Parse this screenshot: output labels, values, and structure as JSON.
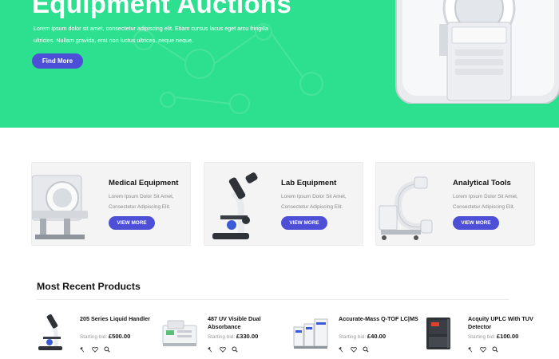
{
  "hero": {
    "title": "Equipment Auctions",
    "text": "Lorem ipsum dolor sit amet, consectetur adipiscing elit. Etiam cursus lacus eget arcu fringilla ultricies. Nullam gravida, erat non luctus ultrices, neque neque.",
    "button_label": "Find More"
  },
  "categories": [
    {
      "title": "Medical Equipment",
      "desc": "Lorem Ipsum Dolor Sit Amet, Consectetur Adipiscing Elit.",
      "button_label": "VIEW MORE",
      "icon": "mri-scanner-icon"
    },
    {
      "title": "Lab Equipment",
      "desc": "Lorem Ipsum Dolor Sit Amet, Consectetur Adipiscing Elit.",
      "button_label": "VIEW MORE",
      "icon": "microscope-icon"
    },
    {
      "title": "Analytical Tools",
      "desc": "Lorem Ipsum Dolor Sit Amet, Consectetur Adipiscing Elit.",
      "button_label": "VIEW MORE",
      "icon": "c-arm-icon"
    }
  ],
  "recent": {
    "title": "Most Recent Products",
    "price_prefix": "Starting bid:",
    "products": [
      {
        "name": "205 Series Liquid Handler",
        "price": "£500.00"
      },
      {
        "name": "487 UV Visible Dual Absorbance",
        "price": "£330.00"
      },
      {
        "name": "Accurate-Mass Q-TOF LC|MS",
        "price": "£40.00"
      },
      {
        "name": "Acquity UPLC With TUV Detector",
        "price": "£100.00"
      }
    ],
    "action_icons": [
      "hammer-icon",
      "heart-icon",
      "zoom-icon"
    ]
  },
  "colors": {
    "hero_bg": "#2de08f",
    "accent": "#4d4fd6",
    "card_bg": "#f4f4f4"
  }
}
